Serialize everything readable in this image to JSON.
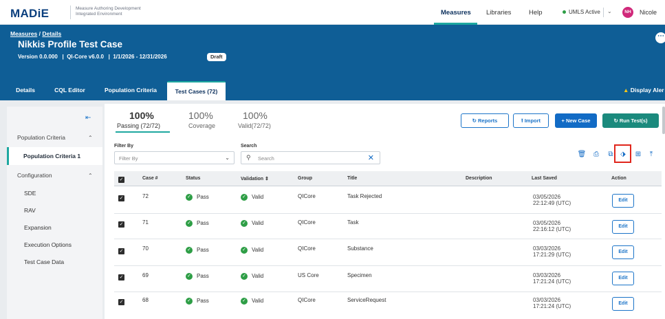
{
  "app": {
    "logo": "MADiE",
    "subtitle_line1": "Measure Authoring Development",
    "subtitle_line2": "Integrated Environment"
  },
  "topnav": {
    "items": [
      "Measures",
      "Libraries",
      "Help"
    ],
    "umls": "UMLS Active",
    "avatar_initials": "NH",
    "user_name": "Nicole"
  },
  "header": {
    "breadcrumb_measures": "Measures",
    "breadcrumb_sep": "/",
    "breadcrumb_details": "Details",
    "title": "Nikkis Profile Test Case",
    "version": "Version 0.0.000",
    "model": "QI-Core v6.0.0",
    "period": "1/1/2026 - 12/31/2026",
    "status": "Draft",
    "display_alerts": "Display Aler"
  },
  "tabs": [
    "Details",
    "CQL Editor",
    "Population Criteria",
    "Test Cases (72)"
  ],
  "sidebar": {
    "group1": "Population Criteria",
    "group1_item": "Population Criteria 1",
    "group2": "Configuration",
    "items": [
      "SDE",
      "RAV",
      "Expansion",
      "Execution Options",
      "Test Case Data"
    ]
  },
  "stats": [
    {
      "pct": "100%",
      "label": "Passing (72/72)"
    },
    {
      "pct": "100%",
      "label": "Coverage"
    },
    {
      "pct": "100%",
      "label": "Valid(72/72)"
    }
  ],
  "actions": {
    "reports": "Reports",
    "import": "Import",
    "new_case": "+ New Case",
    "run_tests": "Run Test(s)"
  },
  "filter": {
    "filter_label": "Filter By",
    "filter_placeholder": "Filter By",
    "search_label": "Search",
    "search_placeholder": "Search"
  },
  "table": {
    "headers": [
      "Case #",
      "Status",
      "Validation",
      "Group",
      "Title",
      "Description",
      "Last Saved",
      "Action"
    ],
    "rows": [
      {
        "case": "72",
        "status": "Pass",
        "validation": "Valid",
        "group": "QICore",
        "title": "Task Rejected",
        "description": "",
        "date": "03/05/2026",
        "time": "22:12:49 (UTC)",
        "action": "Edit"
      },
      {
        "case": "71",
        "status": "Pass",
        "validation": "Valid",
        "group": "QICore",
        "title": "Task",
        "description": "",
        "date": "03/05/2026",
        "time": "22:16:12 (UTC)",
        "action": "Edit"
      },
      {
        "case": "70",
        "status": "Pass",
        "validation": "Valid",
        "group": "QICore",
        "title": "Substance",
        "description": "",
        "date": "03/03/2026",
        "time": "17:21:29 (UTC)",
        "action": "Edit"
      },
      {
        "case": "69",
        "status": "Pass",
        "validation": "Valid",
        "group": "US Core",
        "title": "Specimen",
        "description": "",
        "date": "03/03/2026",
        "time": "17:21:24 (UTC)",
        "action": "Edit"
      },
      {
        "case": "68",
        "status": "Pass",
        "validation": "Valid",
        "group": "QICore",
        "title": "ServiceRequest",
        "description": "",
        "date": "03/03/2026",
        "time": "17:21:24 (UTC)",
        "action": "Edit"
      }
    ]
  },
  "colors": {
    "brand_dark": "#0b3f7e",
    "band": "#0f5e96",
    "accent_teal": "#1ea8a0",
    "primary_blue": "#126bc5",
    "run_green": "#1b8a7d",
    "pass_green": "#2e9e46",
    "highlight_red": "#e0251b"
  }
}
